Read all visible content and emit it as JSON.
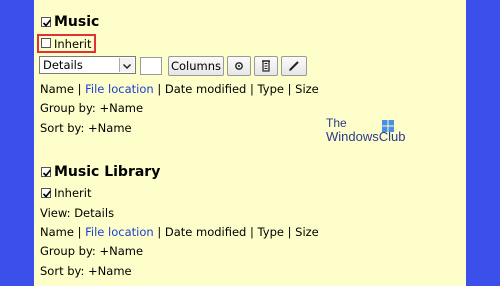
{
  "music": {
    "checkbox_checked": true,
    "title": "Music",
    "inherit_label": "Inherit",
    "inherit_checked": false,
    "view_select_value": "Details",
    "columns_button_label": "Columns",
    "columns_row": {
      "name": "Name",
      "sep1": "|",
      "file_location": "File location",
      "sep2": "|",
      "date_modified": "Date modified",
      "sep3": "|",
      "type": "Type",
      "sep4": "|",
      "size": "Size"
    },
    "group_by": "Group by: +Name",
    "sort_by": "Sort by: +Name"
  },
  "music_library": {
    "checkbox_checked": true,
    "title": "Music Library",
    "inherit_label": "Inherit",
    "inherit_checked": true,
    "view": "View: Details",
    "columns_row": {
      "name": "Name",
      "sep1": "|",
      "file_location": "File location",
      "sep2": "|",
      "date_modified": "Date modified",
      "sep3": "|",
      "type": "Type",
      "sep4": "|",
      "size": "Size"
    },
    "group_by": "Group by: +Name",
    "sort_by": "Sort by: +Name"
  },
  "watermark": {
    "line1": "The",
    "line2": "WindowsClub"
  },
  "colors": {
    "background": "#3b50ea",
    "panel": "#fefecb",
    "link": "#1a3fd4",
    "highlight": "#e0313a"
  },
  "icons": [
    "gear-icon",
    "clear-icon",
    "edit-icon",
    "chevron-down-icon"
  ]
}
